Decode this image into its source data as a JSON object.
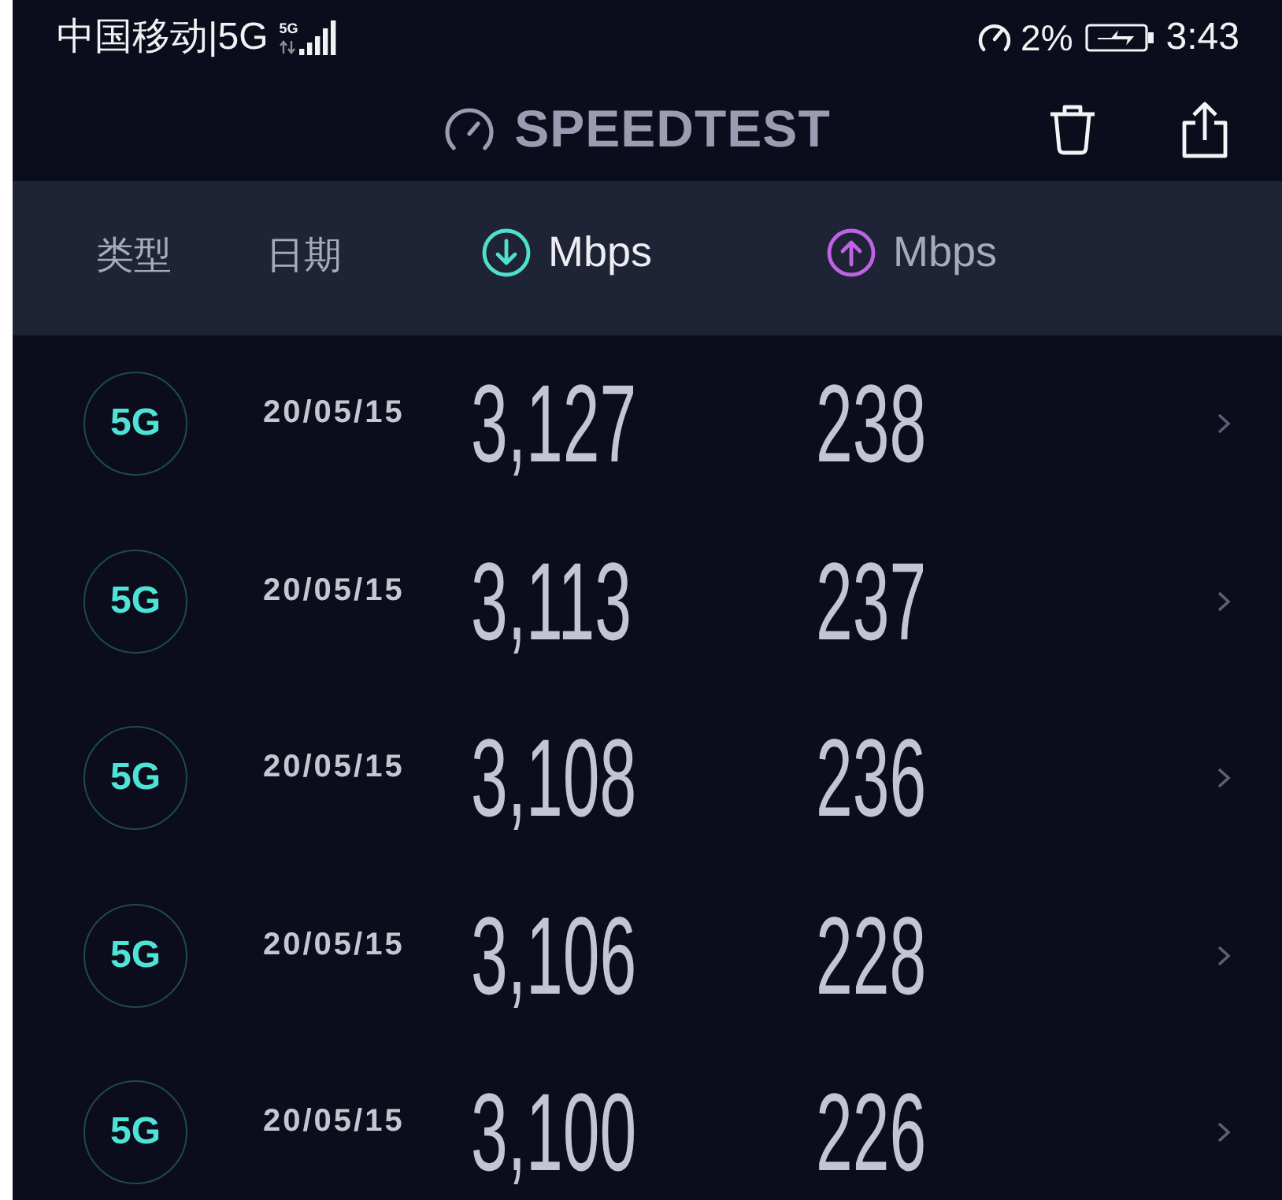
{
  "status_bar": {
    "carrier": "中国移动|5G",
    "network_badge": "5G",
    "indicator_reading": "2%",
    "time": "3:43"
  },
  "header": {
    "title": "SPEEDTEST"
  },
  "columns": [
    {
      "kind": "text",
      "label": "类型",
      "selected": false
    },
    {
      "kind": "text",
      "label": "日期",
      "selected": false
    },
    {
      "kind": "download",
      "label": "Mbps",
      "selected": true
    },
    {
      "kind": "upload",
      "label": "Mbps",
      "selected": false
    }
  ],
  "rows": [
    {
      "network": "5G",
      "date": "20/05/15",
      "download": "3,127",
      "upload": "238"
    },
    {
      "network": "5G",
      "date": "20/05/15",
      "download": "3,113",
      "upload": "237"
    },
    {
      "network": "5G",
      "date": "20/05/15",
      "download": "3,108",
      "upload": "236"
    },
    {
      "network": "5G",
      "date": "20/05/15",
      "download": "3,106",
      "upload": "228"
    },
    {
      "network": "5G",
      "date": "20/05/15",
      "download": "3,100",
      "upload": "226"
    }
  ]
}
